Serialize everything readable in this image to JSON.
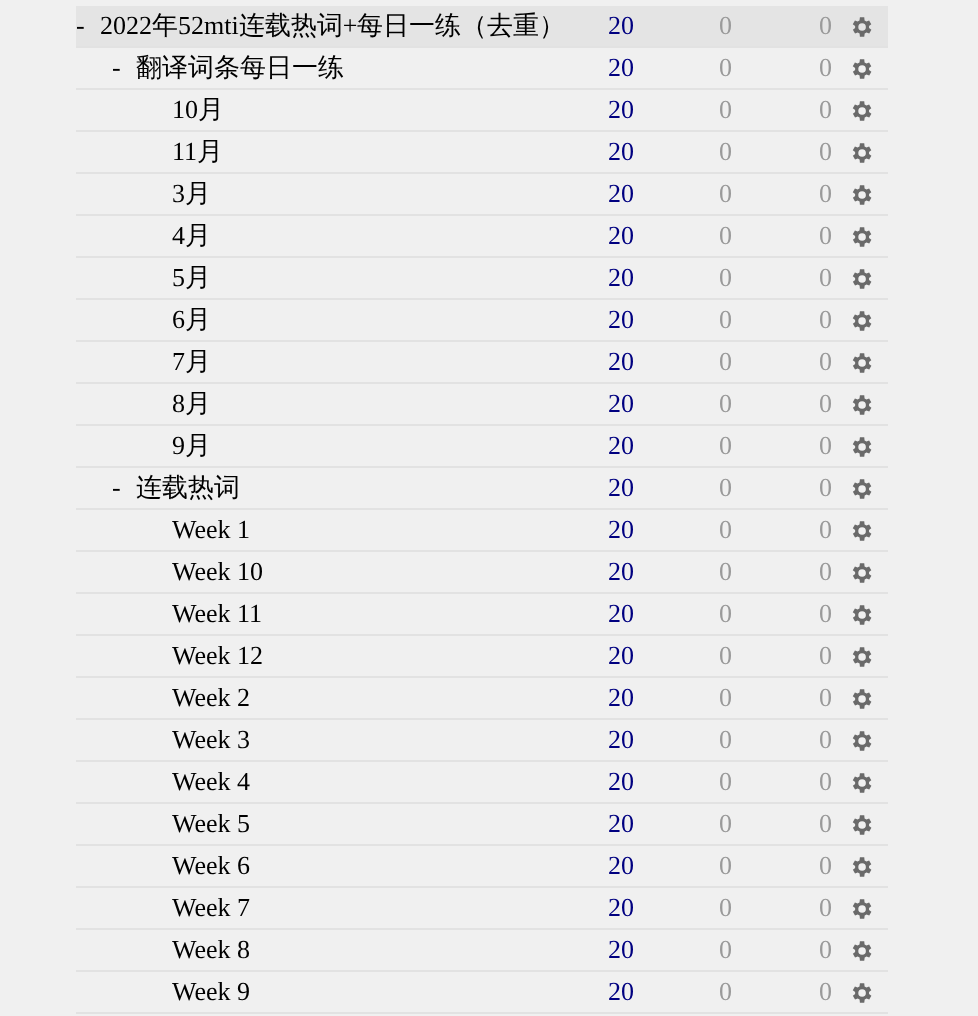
{
  "decks": [
    {
      "toggle": "-",
      "name": "2022年52mti连载热词+每日一练（去重）",
      "new": "20",
      "learn": "0",
      "due": "0",
      "selected": true,
      "children": [
        {
          "toggle": "-",
          "name": "翻译词条每日一练",
          "new": "20",
          "learn": "0",
          "due": "0",
          "selected": false,
          "children": [
            {
              "name": "10月",
              "new": "20",
              "learn": "0",
              "due": "0",
              "selected": false
            },
            {
              "name": "11月",
              "new": "20",
              "learn": "0",
              "due": "0",
              "selected": false
            },
            {
              "name": "3月",
              "new": "20",
              "learn": "0",
              "due": "0",
              "selected": false
            },
            {
              "name": "4月",
              "new": "20",
              "learn": "0",
              "due": "0",
              "selected": false
            },
            {
              "name": "5月",
              "new": "20",
              "learn": "0",
              "due": "0",
              "selected": false
            },
            {
              "name": "6月",
              "new": "20",
              "learn": "0",
              "due": "0",
              "selected": false
            },
            {
              "name": "7月",
              "new": "20",
              "learn": "0",
              "due": "0",
              "selected": false
            },
            {
              "name": "8月",
              "new": "20",
              "learn": "0",
              "due": "0",
              "selected": false
            },
            {
              "name": "9月",
              "new": "20",
              "learn": "0",
              "due": "0",
              "selected": false
            }
          ]
        },
        {
          "toggle": "-",
          "name": "连载热词",
          "new": "20",
          "learn": "0",
          "due": "0",
          "selected": false,
          "children": [
            {
              "name": "Week 1",
              "new": "20",
              "learn": "0",
              "due": "0",
              "selected": false
            },
            {
              "name": "Week 10",
              "new": "20",
              "learn": "0",
              "due": "0",
              "selected": false
            },
            {
              "name": "Week 11",
              "new": "20",
              "learn": "0",
              "due": "0",
              "selected": false
            },
            {
              "name": "Week 12",
              "new": "20",
              "learn": "0",
              "due": "0",
              "selected": false
            },
            {
              "name": "Week 2",
              "new": "20",
              "learn": "0",
              "due": "0",
              "selected": false
            },
            {
              "name": "Week 3",
              "new": "20",
              "learn": "0",
              "due": "0",
              "selected": false
            },
            {
              "name": "Week 4",
              "new": "20",
              "learn": "0",
              "due": "0",
              "selected": false
            },
            {
              "name": "Week 5",
              "new": "20",
              "learn": "0",
              "due": "0",
              "selected": false
            },
            {
              "name": "Week 6",
              "new": "20",
              "learn": "0",
              "due": "0",
              "selected": false
            },
            {
              "name": "Week 7",
              "new": "20",
              "learn": "0",
              "due": "0",
              "selected": false
            },
            {
              "name": "Week 8",
              "new": "20",
              "learn": "0",
              "due": "0",
              "selected": false
            },
            {
              "name": "Week 9",
              "new": "20",
              "learn": "0",
              "due": "0",
              "selected": false
            }
          ]
        }
      ]
    }
  ]
}
